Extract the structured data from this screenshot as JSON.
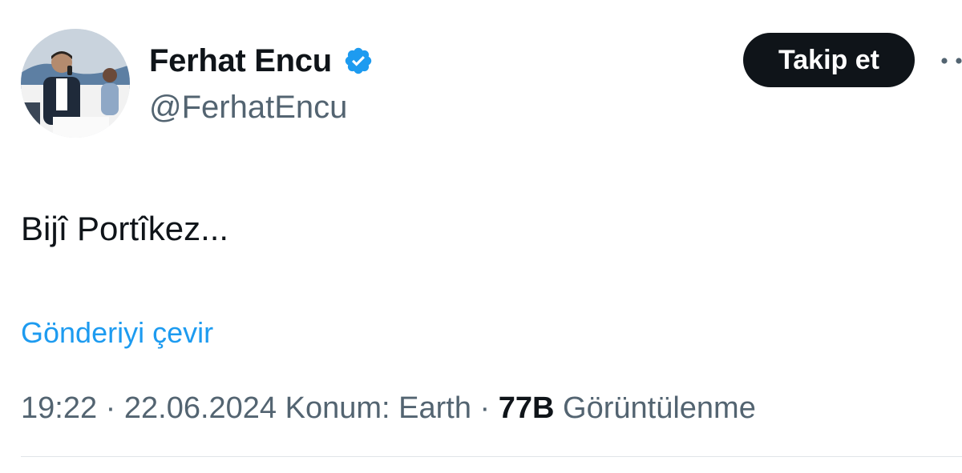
{
  "author": {
    "display_name": "Ferhat Encu",
    "handle": "@FerhatEncu",
    "verified_icon": "verified-badge-icon",
    "verified_color": "#1d9bf0"
  },
  "actions": {
    "follow_label": "Takip et",
    "more_icon": "more-dots-icon"
  },
  "tweet": {
    "text": "Bijî Portîkez...",
    "translate_label": "Gönderiyi çevir"
  },
  "meta": {
    "time": "19:22",
    "separator": "·",
    "date": "22.06.2024",
    "location": "Konum: Earth",
    "views_count": "77B",
    "views_label": "Görüntülenme"
  },
  "colors": {
    "text": "#0f1419",
    "secondary": "#536471",
    "link": "#1d9bf0",
    "button_bg": "#0f1419"
  }
}
